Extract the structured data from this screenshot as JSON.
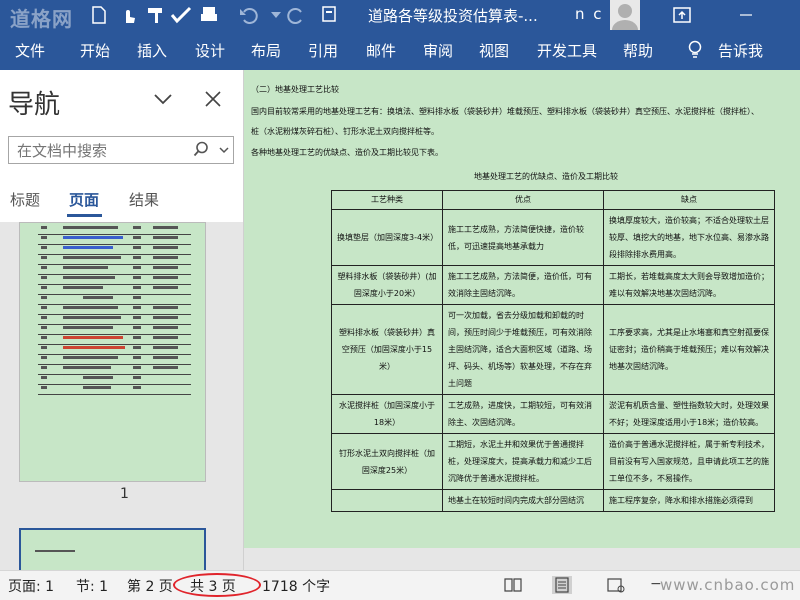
{
  "titlebar": {
    "watermark": "道格网",
    "doc_title": "道路各等级投资估算表-...",
    "user": "n c"
  },
  "ribbon": {
    "tabs": [
      "文件",
      "开始",
      "插入",
      "设计",
      "布局",
      "引用",
      "邮件",
      "审阅",
      "视图",
      "开发工具",
      "帮助",
      "告诉我"
    ]
  },
  "nav": {
    "title": "导航",
    "search_placeholder": "在文档中搜索",
    "tabs": [
      "标题",
      "页面",
      "结果"
    ],
    "active_tab": "页面",
    "page_label": "1"
  },
  "document": {
    "heading": "（二）地基处理工艺比较",
    "para1_line1": "国内目前较常采用的地基处理工艺有：换填法、塑料排水板（袋装砂井）堆载预压、塑料排水板（袋装砂井）真空预压、水泥搅拌桩（搅拌桩）、",
    "para1_line2": "桩（水泥粉煤灰碎石桩）、钉形水泥土双向搅拌桩等。",
    "para2": "各种地基处理工艺的优缺点、造价及工期比较见下表。",
    "table_caption": "地基处理工艺的优缺点、造价及工期比较",
    "table_headers": [
      "工艺种类",
      "优点",
      "缺点"
    ],
    "table_rows": [
      [
        "换填垫层（加固深度3-4米）",
        "施工工艺成熟，方法简便快捷，造价较低，可迅速提高地基承载力",
        "换填厚度较大，造价较高；不适合处理软土层较厚、填挖大的地基，地下水位高、易渗水路段排除排水费用高。"
      ],
      [
        "塑料排水板（袋装砂井）(加固深度小于20米）",
        "施工工艺成熟，方法简便，造价低，可有效消除主固结沉降。",
        "工期长，若堆载高度太大则会导致增加造价；难以有效解决地基次固结沉降。"
      ],
      [
        "塑料排水板（袋装砂井）真空预压（加固深度小于15米）",
        "可一次加载，省去分级加载和卸载的时间，预压时间少于堆载预压，可有效消除主固结沉降，适合大面积区域（道路、场坪、码头、机场等）软基处理，不存在弃土问题",
        "工序要求高，尤其是止水堵塞和真空射孤要保证密封；造价稍高于堆载预压；难以有效解决地基次固结沉降。"
      ],
      [
        "水泥搅拌桩（加固深度小于18米）",
        "工艺成熟，进度快，工期较短，可有效消除主、次固结沉降。",
        "淤泥有机质含量、塑性指数较大时，处理效果不好；处理深度适用小于18米；造价较高。"
      ],
      [
        "钉形水泥土双向搅拌桩（加固深度25米）",
        "工期短，水泥土并和效果优于普通搅拌桩，处理深度大，提高承载力和减少工后沉降优于普通水泥搅拌桩。",
        "造价高于普通水泥搅拌桩，属于新专利技术，目前没有写入国家规范，且申请此项工艺的施工单位不多，不易操作。"
      ],
      [
        "",
        "地基土在较短时间内完成大部分固结沉",
        "施工程序复杂，降水和排水措施必须得到"
      ]
    ]
  },
  "status": {
    "page": "页面: 1",
    "section": "节: 1",
    "page_of": "第 2 页",
    "total_pages": "共 3 页",
    "word_count": "1718 个字",
    "watermark": "www.cnbao.com"
  },
  "colors": {
    "ribbon": "#2b579a",
    "page_background": "#c7e6c7",
    "highlight_ellipse": "#e0242b"
  }
}
